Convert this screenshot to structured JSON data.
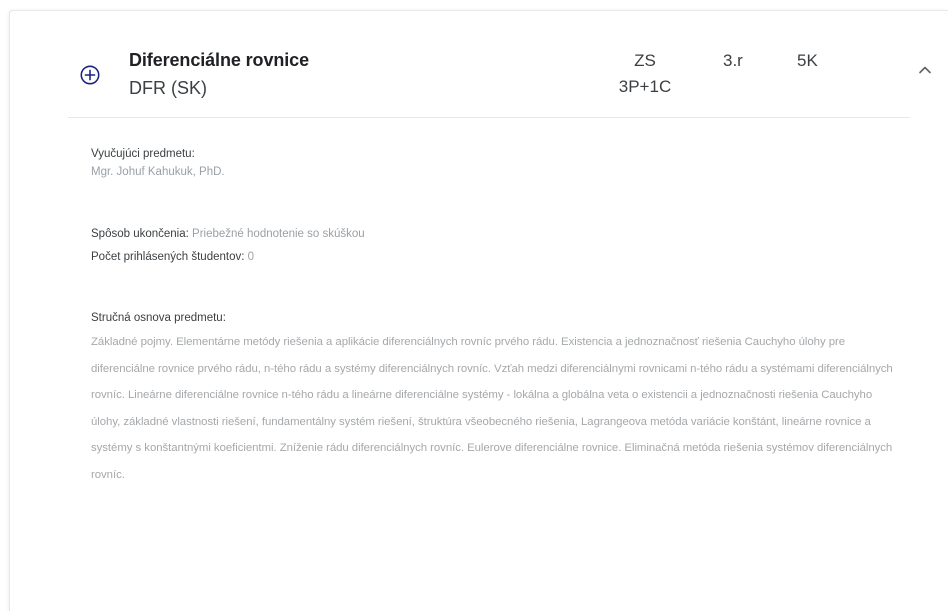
{
  "course": {
    "title": "Diferenciálne rovnice",
    "code": "DFR (SK)",
    "semester": "ZS",
    "hours": "3P+1C",
    "year": "3.r",
    "credits": "5K"
  },
  "details": {
    "teacher_label": "Vyučujúci predmetu:",
    "teacher_value": "Mgr. Johuf Kahukuk, PhD.",
    "completion_label": "Spôsob ukončenia",
    "completion_value": "Priebežné hodnotenie so skúškou",
    "students_label": "Počet prihlásených študentov",
    "students_value": "0",
    "syllabus_label": "Stručná osnova predmetu:",
    "syllabus_text": "Základné pojmy. Elementárne metódy riešenia a aplikácie diferenciálnych rovníc prvého rádu. Existencia a jednoznačnosť riešenia Cauchyho úlohy pre diferenciálne rovnice prvého rádu, n-tého rádu a systémy diferenciálnych rovníc. Vzťah medzi diferenciálnymi rovnicami n-tého rádu a systémami diferenciálnych rovníc. Lineárne diferenciálne rovnice n-tého rádu a lineárne diferenciálne systémy - lokálna a globálna veta o existencii a jednoznačnosti riešenia Cauchyho úlohy, základné vlastnosti riešení, fundamentálny systém riešení, štruktúra všeobecného riešenia, Lagrangeova metóda variácie konštánt, lineárne rovnice a systémy s konštantnými koeficientmi. Zníženie rádu diferenciálnych rovníc. Eulerove diferenciálne rovnice. Eliminačná metóda riešenia systémov diferenciálnych rovníc."
  },
  "colors": {
    "accent": "#1a237e",
    "title": "#202124",
    "muted": "#9aa0a6"
  },
  "icons": {
    "add": "plus-circle-icon",
    "collapse": "chevron-up-icon"
  }
}
